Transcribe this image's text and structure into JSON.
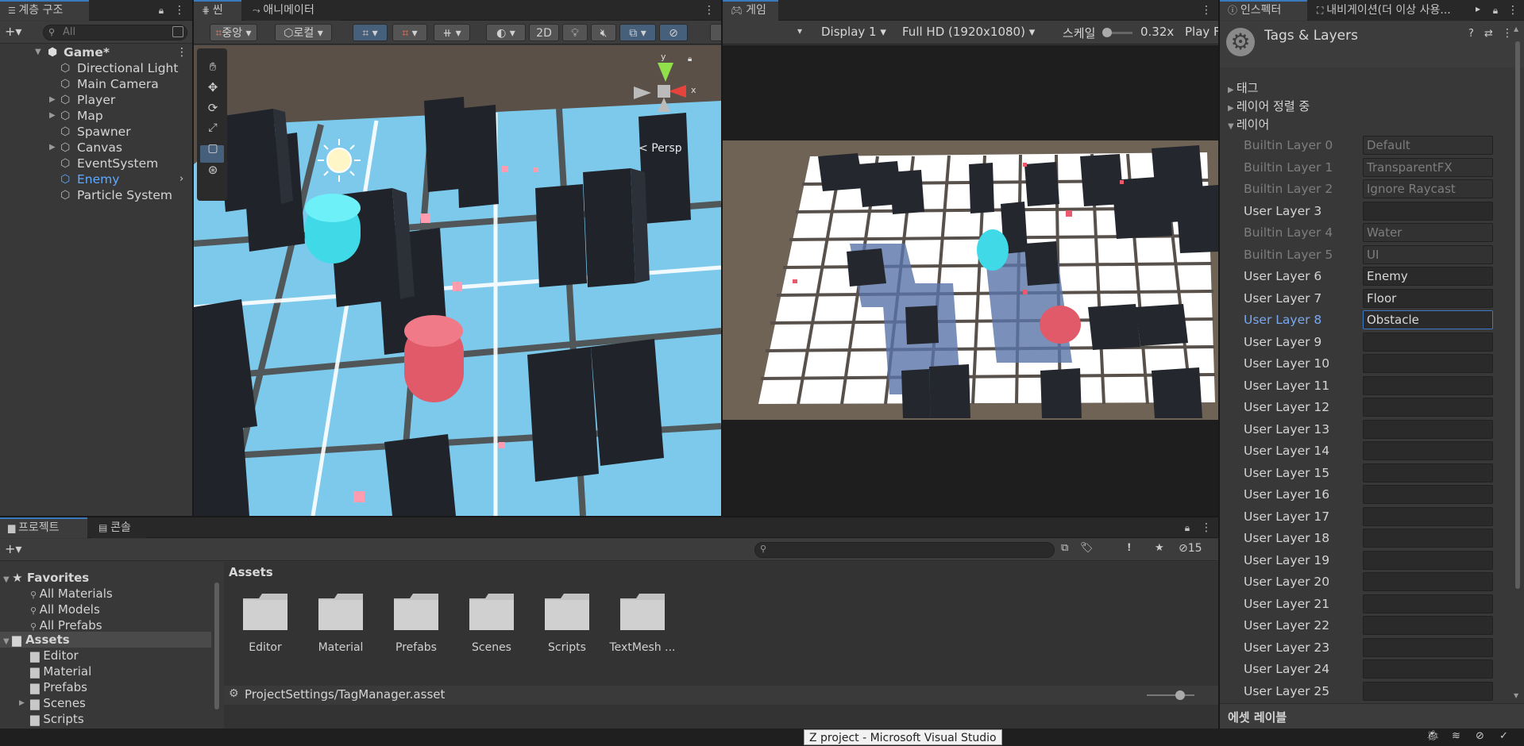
{
  "hierarchy": {
    "tab_label": "계층 구조",
    "add_label": "+▾",
    "search_placeholder": "All",
    "scene_name": "Game*",
    "items": [
      {
        "label": "Directional Light",
        "expandable": false
      },
      {
        "label": "Main Camera",
        "expandable": false
      },
      {
        "label": "Player",
        "expandable": true
      },
      {
        "label": "Map",
        "expandable": true
      },
      {
        "label": "Spawner",
        "expandable": false
      },
      {
        "label": "Canvas",
        "expandable": true
      },
      {
        "label": "EventSystem",
        "expandable": false
      },
      {
        "label": "Enemy",
        "expandable": false,
        "prefab": true
      },
      {
        "label": "Particle System",
        "expandable": false
      }
    ]
  },
  "scene": {
    "tab_label": "씬",
    "animator_tab_label": "애니메이터",
    "pivot_label": "중앙",
    "space_label": "로컬",
    "mode_2d_label": "2D",
    "persp_label": "Persp",
    "gizmo_x_label": "x",
    "gizmo_y_label": "y"
  },
  "game": {
    "tab_label": "게임",
    "display_label": "Display 1",
    "resolution_label": "Full HD (1920x1080)",
    "scale_label": "스케일",
    "scale_value": "0.32x",
    "play_label": "Play F"
  },
  "inspector": {
    "tab_label": "인스펙터",
    "nav_tab_label": "내비게이션(더 이상 사용...",
    "title": "Tags & Layers",
    "sections": {
      "tags": "태그",
      "sorting": "레이어 정렬 중",
      "layers": "레이어"
    },
    "layers": [
      {
        "name": "Builtin Layer 0",
        "value": "Default",
        "builtin": true
      },
      {
        "name": "Builtin Layer 1",
        "value": "TransparentFX",
        "builtin": true
      },
      {
        "name": "Builtin Layer 2",
        "value": "Ignore Raycast",
        "builtin": true
      },
      {
        "name": "User Layer 3",
        "value": "",
        "builtin": false
      },
      {
        "name": "Builtin Layer 4",
        "value": "Water",
        "builtin": true
      },
      {
        "name": "Builtin Layer 5",
        "value": "UI",
        "builtin": true
      },
      {
        "name": "User Layer 6",
        "value": "Enemy",
        "builtin": false
      },
      {
        "name": "User Layer 7",
        "value": "Floor",
        "builtin": false
      },
      {
        "name": "User Layer 8",
        "value": "Obstacle",
        "builtin": false,
        "selected": true
      },
      {
        "name": "User Layer 9",
        "value": "",
        "builtin": false
      },
      {
        "name": "User Layer 10",
        "value": "",
        "builtin": false
      },
      {
        "name": "User Layer 11",
        "value": "",
        "builtin": false
      },
      {
        "name": "User Layer 12",
        "value": "",
        "builtin": false
      },
      {
        "name": "User Layer 13",
        "value": "",
        "builtin": false
      },
      {
        "name": "User Layer 14",
        "value": "",
        "builtin": false
      },
      {
        "name": "User Layer 15",
        "value": "",
        "builtin": false
      },
      {
        "name": "User Layer 16",
        "value": "",
        "builtin": false
      },
      {
        "name": "User Layer 17",
        "value": "",
        "builtin": false
      },
      {
        "name": "User Layer 18",
        "value": "",
        "builtin": false
      },
      {
        "name": "User Layer 19",
        "value": "",
        "builtin": false
      },
      {
        "name": "User Layer 20",
        "value": "",
        "builtin": false
      },
      {
        "name": "User Layer 21",
        "value": "",
        "builtin": false
      },
      {
        "name": "User Layer 22",
        "value": "",
        "builtin": false
      },
      {
        "name": "User Layer 23",
        "value": "",
        "builtin": false
      },
      {
        "name": "User Layer 24",
        "value": "",
        "builtin": false
      },
      {
        "name": "User Layer 25",
        "value": "",
        "builtin": false
      }
    ],
    "footer_label": "에셋 레이블"
  },
  "project": {
    "tab_label": "프로젝트",
    "console_tab_label": "콘솔",
    "hidden_count": "15",
    "favorites_label": "Favorites",
    "favorites": [
      "All Materials",
      "All Models",
      "All Prefabs"
    ],
    "assets_label": "Assets",
    "asset_tree": [
      {
        "label": "Editor",
        "expandable": false
      },
      {
        "label": "Material",
        "expandable": false
      },
      {
        "label": "Prefabs",
        "expandable": false
      },
      {
        "label": "Scenes",
        "expandable": true
      },
      {
        "label": "Scripts",
        "expandable": false
      }
    ],
    "breadcrumb": "Assets",
    "folders": [
      "Editor",
      "Material",
      "Prefabs",
      "Scenes",
      "Scripts",
      "TextMesh ..."
    ],
    "selected_path": "ProjectSettings/TagManager.asset"
  },
  "statusbar": {
    "tooltip": "Z project - Microsoft Visual Studio"
  },
  "colors": {
    "accent": "#3a79bb",
    "selected_text": "#7aa8ef",
    "prefab_blue": "#5fa9ff",
    "panel_bg": "#383838",
    "floor_blue": "#7cc9ec"
  }
}
